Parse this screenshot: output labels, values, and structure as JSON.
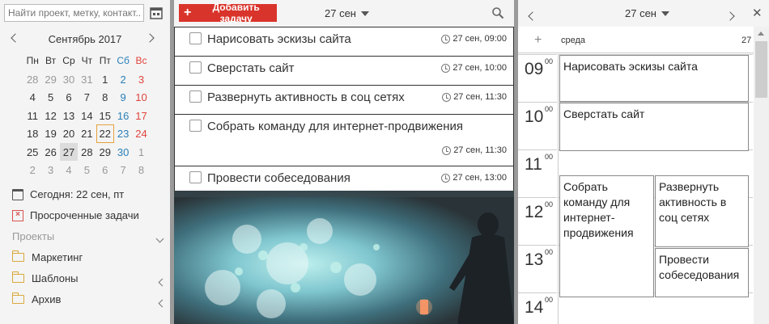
{
  "sidebar": {
    "search_placeholder": "Найти проект, метку, контакт...",
    "calendar": {
      "title": "Сентябрь 2017",
      "dow": [
        "Пн",
        "Вт",
        "Ср",
        "Чт",
        "Пт",
        "Сб",
        "Вс"
      ],
      "weeks": [
        [
          {
            "d": "28",
            "o": true
          },
          {
            "d": "29",
            "o": true
          },
          {
            "d": "30",
            "o": true
          },
          {
            "d": "31",
            "o": true
          },
          {
            "d": "1"
          },
          {
            "d": "2"
          },
          {
            "d": "3"
          }
        ],
        [
          {
            "d": "4"
          },
          {
            "d": "5"
          },
          {
            "d": "6"
          },
          {
            "d": "7"
          },
          {
            "d": "8"
          },
          {
            "d": "9"
          },
          {
            "d": "10"
          }
        ],
        [
          {
            "d": "11"
          },
          {
            "d": "12"
          },
          {
            "d": "13"
          },
          {
            "d": "14"
          },
          {
            "d": "15"
          },
          {
            "d": "16"
          },
          {
            "d": "17"
          }
        ],
        [
          {
            "d": "18"
          },
          {
            "d": "19"
          },
          {
            "d": "20"
          },
          {
            "d": "21"
          },
          {
            "d": "22",
            "today": true
          },
          {
            "d": "23"
          },
          {
            "d": "24"
          }
        ],
        [
          {
            "d": "25"
          },
          {
            "d": "26"
          },
          {
            "d": "27",
            "sel": true
          },
          {
            "d": "28"
          },
          {
            "d": "29"
          },
          {
            "d": "30"
          },
          {
            "d": "1",
            "o": true
          }
        ],
        [
          {
            "d": "2",
            "o": true
          },
          {
            "d": "3",
            "o": true
          },
          {
            "d": "4",
            "o": true
          },
          {
            "d": "5",
            "o": true
          },
          {
            "d": "6",
            "o": true
          },
          {
            "d": "7",
            "o": true
          },
          {
            "d": "8",
            "o": true
          }
        ]
      ]
    },
    "today_label": "Сегодня: 22 сен, пт",
    "overdue_label": "Просроченные задачи",
    "projects_label": "Проекты",
    "folders": [
      "Маркетинг",
      "Шаблоны",
      "Архив"
    ]
  },
  "tasks_pane": {
    "add_label": "Добавить задачу",
    "date_label": "27 сен",
    "tasks": [
      {
        "title": "Нарисовать эскизы сайта",
        "time": "27 сен, 09:00"
      },
      {
        "title": "Сверстать сайт",
        "time": "27 сен, 10:00"
      },
      {
        "title": "Развернуть активность в соц сетях",
        "time": "27 сен, 11:30"
      },
      {
        "title": "Собрать команду для интернет-продвижения",
        "time": "27 сен, 11:30"
      },
      {
        "title": "Провести собеседования",
        "time": "27 сен, 13:00"
      }
    ]
  },
  "day_view": {
    "date_label": "27 сен",
    "day_name": "среда",
    "day_number": "27",
    "hours": [
      {
        "h": "09",
        "m": "00"
      },
      {
        "h": "10",
        "m": "00"
      },
      {
        "h": "11",
        "m": "00"
      },
      {
        "h": "12",
        "m": "00"
      },
      {
        "h": "13",
        "m": "00"
      },
      {
        "h": "14",
        "m": "00"
      }
    ],
    "events": [
      {
        "title": "Нарисовать эскизы сайта"
      },
      {
        "title": "Сверстать сайт"
      },
      {
        "title": "Собрать команду для интернет-продвижения"
      },
      {
        "title": "Развернуть активность в соц сетях"
      },
      {
        "title": "Провести собеседования"
      }
    ]
  },
  "colors": {
    "accent": "#d9342b",
    "weekend_sat": "#2a7fb8",
    "weekend_sun": "#e0443d",
    "today_border": "#e6a33c",
    "folder": "#d9a83b"
  }
}
